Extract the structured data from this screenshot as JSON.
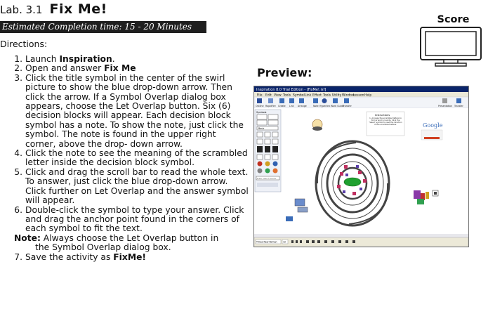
{
  "lab": {
    "number": "Lab. 3.1",
    "title": "Fix Me!"
  },
  "banner": "Estimated Completion time: 15 - 20 Minutes",
  "directions_label": "Directions:",
  "steps": [
    {
      "n": "1.",
      "pre": "Launch ",
      "bold": "Inspiration",
      "post": "."
    },
    {
      "n": "2.",
      "pre": "Open and answer ",
      "bold": "Fix Me",
      "post": ""
    },
    {
      "n": "3.",
      "pre": "Click the title symbol in the center of the swirl picture to show the blue drop-down arrow. Then click the arrow. If a Symbol Overlap dialog box appears, choose the Let Overlap button. Six (6) decision blocks will appear. Each decision block symbol has a note. To show the note, just click the symbol. The note is found in the upper right corner, above the drop- down arrow.",
      "bold": "",
      "post": ""
    },
    {
      "n": "4.",
      "pre": "Click the note to see the meaning of the scrambled letter inside the decision block symbol.",
      "bold": "",
      "post": ""
    },
    {
      "n": "5.",
      "pre": "Click and drag the scroll bar to read the whole text. To answer, just click the blue drop-down arrow. Click further on Let Overlap and the answer symbol will appear.",
      "bold": "",
      "post": ""
    },
    {
      "n": "6.",
      "pre": "Double-click the symbol to type your answer. Click and drag the anchor point found in the corners of each symbol to fit the text.",
      "bold": "",
      "post": ""
    }
  ],
  "note": {
    "label": "Note:",
    "text": " Always choose the Let Overlap button in",
    "text2": "the Symbol Overlap dialog box."
  },
  "last_step": {
    "n": "7.",
    "pre": "Save the activity as ",
    "bold": "FixMe!",
    "post": ""
  },
  "score_label": "Score",
  "preview_label": "Preview:",
  "preview": {
    "window_title": "Inspiration 8.0 Trial Edition - [FixMe!.isf]",
    "menu": [
      "File",
      "Edit",
      "View",
      "Tools",
      "Symbol",
      "Link",
      "Effect",
      "Tools",
      "Utility",
      "Window",
      "Lesson",
      "Help"
    ],
    "toolbar": [
      "Outline",
      "RapidFire",
      "Create",
      "Link",
      "Arrange",
      "Note",
      "Hyperlink",
      "Word Guide",
      "Transfer"
    ],
    "toolbar_right": [
      "Presentation",
      "Transfer"
    ],
    "side_panel": [
      "Symbols",
      "Basic"
    ],
    "search_placeholder": "Enter search words",
    "instructions_title": "Instructions",
    "instructions_text": "1. Arrange the scrambled letters to form a word or words. Click the 'Select' symbol to read the direction of the scrambled letters.",
    "google_text": "Google",
    "status": "Times New Roman",
    "status_size": "12",
    "colors": {
      "titlebar": "#0a246a",
      "swirl": "#444444",
      "accent": "#d04020"
    }
  }
}
